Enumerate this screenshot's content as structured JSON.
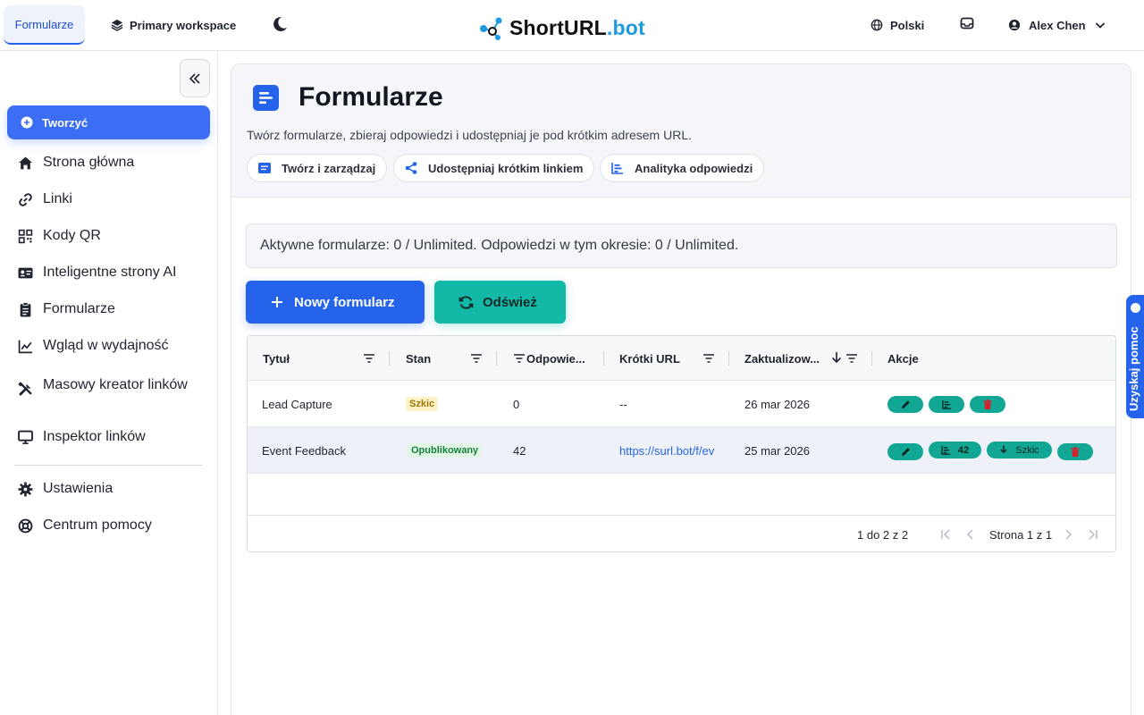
{
  "topbar": {
    "active_tab": "Formularze",
    "workspace": "Primary workspace",
    "logo_main": "ShortURL",
    "logo_suffix": ".bot",
    "language": "Polski",
    "user_name": "Alex Chen"
  },
  "sidebar": {
    "create_label": "Tworzyć",
    "items": [
      {
        "label": "Strona główna",
        "icon": "home-icon"
      },
      {
        "label": "Linki",
        "icon": "link-icon"
      },
      {
        "label": "Kody QR",
        "icon": "qr-code-icon"
      },
      {
        "label": "Inteligentne strony AI",
        "icon": "id-card-icon"
      },
      {
        "label": "Formularze",
        "icon": "clipboard-icon"
      },
      {
        "label": "Wgląd w wydajność",
        "icon": "chart-line-icon"
      },
      {
        "label": "Masowy kreator linków",
        "icon": "tools-icon"
      },
      {
        "label": "Inspektor linków",
        "icon": "monitor-icon"
      }
    ],
    "bottom_items": [
      {
        "label": "Ustawienia",
        "icon": "gear-icon"
      },
      {
        "label": "Centrum pomocy",
        "icon": "lifebuoy-icon"
      }
    ]
  },
  "header": {
    "title": "Formularze",
    "description": "Twórz formularze, zbieraj odpowiedzi i udostępniaj je pod krótkim adresem URL.",
    "chips": [
      "Twórz i zarządzaj",
      "Udostępniaj krótkim linkiem",
      "Analityka odpowiedzi"
    ]
  },
  "info": "Aktywne formularze: 0 / Unlimited. Odpowiedzi w tym okresie: 0 / Unlimited.",
  "actions": {
    "new_form": "Nowy formularz",
    "refresh": "Odśwież"
  },
  "table": {
    "columns": [
      "Tytuł",
      "Stan",
      "Odpowie...",
      "Krótki URL",
      "Zaktualizow...",
      "Akcje"
    ],
    "rows": [
      {
        "title": "Lead Capture",
        "status": "Szkic",
        "responses": "0",
        "url": "--",
        "updated": "26 mar 2026"
      },
      {
        "title": "Event Feedback",
        "status": "Opublikowany",
        "responses": "42",
        "url": "https://surl.bot/f/ev",
        "updated": "25 mar 2026",
        "analytics_count": "42",
        "export_label": "Szkic"
      }
    ],
    "footer_count": "1 do 2 z 2",
    "footer_page": "Strona 1 z 1"
  },
  "help_tab": "Uzyskaj pomoc",
  "colors": {
    "primary": "#2563eb",
    "teal": "#14b8a6",
    "draft_badge": "#fdf3c7",
    "published_badge": "#e2f6e6"
  }
}
